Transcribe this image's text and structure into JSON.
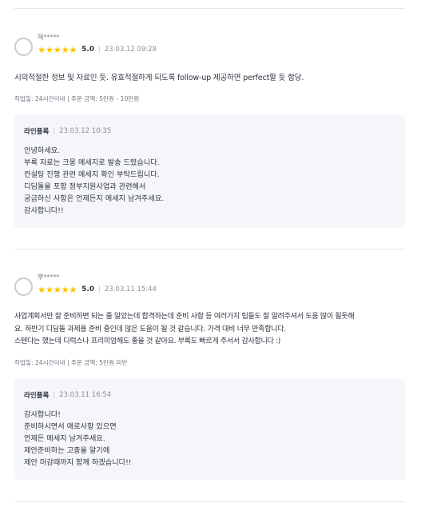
{
  "reviews": [
    {
      "username": "헤*****",
      "score": "5.0",
      "separator": "|",
      "date": "23.03.12 09:28",
      "stars": 5,
      "body": "시의적절한 정보 및 자료인 듯. 유효적절하게 되도록 follow-up 제공하면 perfect할 듯 함당.",
      "info": "작업일: 24시간이내 | 주문 금액: 5만원 - 10만원",
      "reply": {
        "name": "라인플록",
        "date": "23.03.12 10:35",
        "lines": [
          "안녕하세요.",
          "부록 자료는 크몽 메세지로 발송 드렸습니다.",
          "컨설팅 진행 관련 메세지 확인 부탁드립니다.",
          "디딤돌을 포함 정부지원사업과 관련해서",
          "궁금하신 사항은 언제든지 메세지 남겨주세요.",
          "감사합니다!!"
        ]
      }
    },
    {
      "username": "뿌*****",
      "score": "5.0",
      "separator": "|",
      "date": "23.03.11 15:44",
      "stars": 5,
      "body_lines": [
        "사업계획서만 잘 준비하면 되는 줄 알았는데 합격하는데 준비 사항 등 여러가지 팁들도 잘 알려주셔서 도움 많이 될듯해",
        "요. 하반기 디딤돌 과제를 준비 중인데 많은 도움이 될 것 같습니다. 가격 대비 너무 만족합니다.",
        "스텐다는 했는데 디럭스나 프리미엄해도 좋을 것 같아요.  부록도 빠르게 주서서 감사합니다 :)"
      ],
      "info": "작업일: 24시간이내 | 주문 금액: 5만원 미만",
      "reply": {
        "name": "라인플록",
        "date": "23.03.11 16:54",
        "lines": [
          "감사합니다!",
          "준비하시면서 애로사항 있으면",
          "언제든 메세지 남겨주세요.",
          "제안준비하는 고충을 알기에",
          "제안 마감때까지 함께 하겠습니다!!"
        ]
      }
    }
  ]
}
